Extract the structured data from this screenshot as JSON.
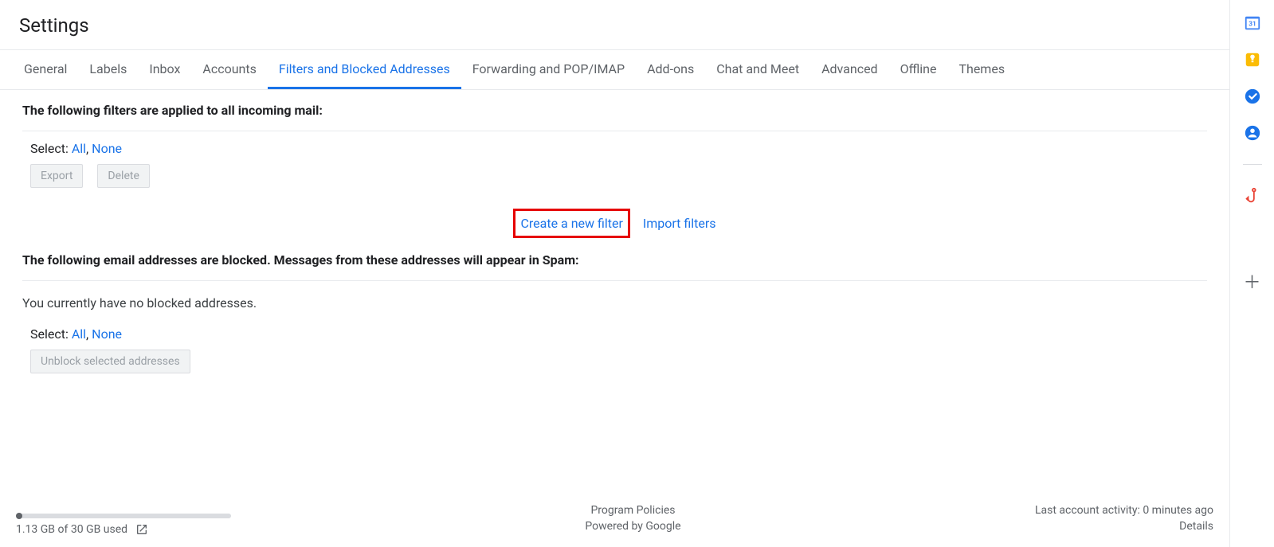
{
  "pageTitle": "Settings",
  "tabs": [
    {
      "label": "General",
      "active": false
    },
    {
      "label": "Labels",
      "active": false
    },
    {
      "label": "Inbox",
      "active": false
    },
    {
      "label": "Accounts",
      "active": false
    },
    {
      "label": "Filters and Blocked Addresses",
      "active": true
    },
    {
      "label": "Forwarding and POP/IMAP",
      "active": false
    },
    {
      "label": "Add-ons",
      "active": false
    },
    {
      "label": "Chat and Meet",
      "active": false
    },
    {
      "label": "Advanced",
      "active": false
    },
    {
      "label": "Offline",
      "active": false
    },
    {
      "label": "Themes",
      "active": false
    }
  ],
  "filters": {
    "heading": "The following filters are applied to all incoming mail:",
    "selectLabel": "Select:",
    "all": "All",
    "none": "None",
    "exportBtn": "Export",
    "deleteBtn": "Delete",
    "createLink": "Create a new filter",
    "importLink": "Import filters"
  },
  "blocked": {
    "heading": "The following email addresses are blocked. Messages from these addresses will appear in Spam:",
    "status": "You currently have no blocked addresses.",
    "selectLabel": "Select:",
    "all": "All",
    "none": "None",
    "unblockBtn": "Unblock selected addresses"
  },
  "footer": {
    "storage": "1.13 GB of 30 GB used",
    "policies": "Program Policies",
    "powered": "Powered by Google",
    "activity": "Last account activity: 0 minutes ago",
    "details": "Details"
  }
}
